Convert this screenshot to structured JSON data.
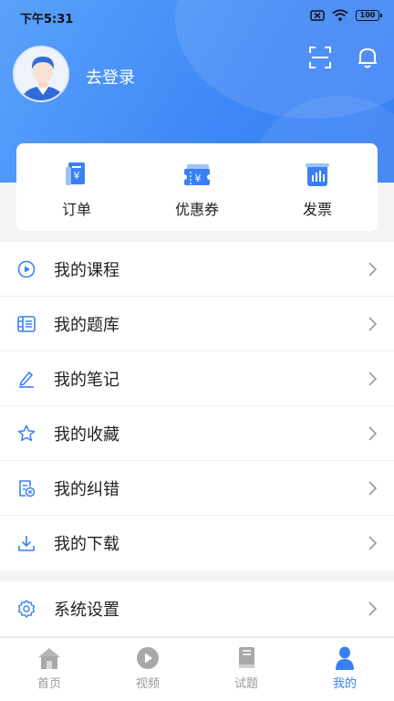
{
  "status_bar": {
    "time": "下午5:31",
    "battery": "100"
  },
  "profile": {
    "login_label": "去登录"
  },
  "quick_actions": [
    {
      "label": "订单",
      "icon": "order-icon"
    },
    {
      "label": "优惠券",
      "icon": "coupon-icon"
    },
    {
      "label": "发票",
      "icon": "invoice-icon"
    }
  ],
  "menu": [
    {
      "label": "我的课程",
      "icon": "play-circle-icon"
    },
    {
      "label": "我的题库",
      "icon": "question-bank-icon"
    },
    {
      "label": "我的笔记",
      "icon": "pen-icon"
    },
    {
      "label": "我的收藏",
      "icon": "star-icon"
    },
    {
      "label": "我的纠错",
      "icon": "error-correction-icon"
    },
    {
      "label": "我的下载",
      "icon": "download-icon"
    }
  ],
  "settings": {
    "label": "系统设置",
    "icon": "gear-icon"
  },
  "tabs": [
    {
      "label": "首页",
      "icon": "home-icon"
    },
    {
      "label": "视频",
      "icon": "video-icon"
    },
    {
      "label": "试题",
      "icon": "book-icon"
    },
    {
      "label": "我的",
      "icon": "user-icon",
      "active": true
    }
  ],
  "colors": {
    "accent": "#3a80f4",
    "header_start": "#5aa2fb",
    "icon_gray": "#a8a8a8"
  }
}
